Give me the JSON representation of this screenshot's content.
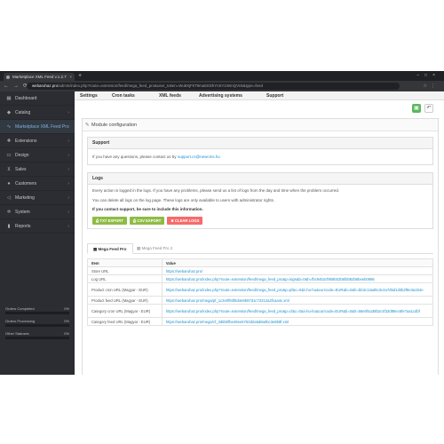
{
  "browser": {
    "tab_title": "Marketplace XML Feed v.1.2.7",
    "url_host": "webaruhaz.pro",
    "url_path": "/admin/index.php?route=extension/feed/mega_feed_pro&user_token=Wu8XjFkT9ma5XDhYnSY1WmQVnk&type=feed"
  },
  "sidebar": {
    "items": [
      {
        "label": "Dashboard",
        "icon": "dashboard-icon",
        "glyph": "▦"
      },
      {
        "label": "Catalog",
        "icon": "tag-icon",
        "glyph": "◆"
      },
      {
        "label": "Marketplace XML Feed Pro",
        "icon": "chart-icon",
        "glyph": "∿"
      },
      {
        "label": "Extensions",
        "icon": "puzzle-icon",
        "glyph": "✚"
      },
      {
        "label": "Design",
        "icon": "monitor-icon",
        "glyph": "▭"
      },
      {
        "label": "Sales",
        "icon": "cart-icon",
        "glyph": "⊻"
      },
      {
        "label": "Customers",
        "icon": "user-icon",
        "glyph": "●"
      },
      {
        "label": "Marketing",
        "icon": "share-icon",
        "glyph": "◁"
      },
      {
        "label": "System",
        "icon": "gear-icon",
        "glyph": "✲"
      },
      {
        "label": "Reports",
        "icon": "bar-chart-icon",
        "glyph": "▮"
      }
    ],
    "stats": [
      {
        "label": "Orders Completed",
        "value": "0%"
      },
      {
        "label": "Orders Processing",
        "value": "0%"
      },
      {
        "label": "Other Statuses",
        "value": "0%"
      }
    ]
  },
  "topnav": {
    "settings": "Settings",
    "cron": "Cron tasks",
    "xml": "XML feeds",
    "advertising": "Advertising systems",
    "support": "Support"
  },
  "panel": {
    "title": "Module configuration"
  },
  "support": {
    "heading": "Support",
    "text": "If you have any questions, please contact us by",
    "email": "support.cs@newcms.hu"
  },
  "logs": {
    "heading": "Logs",
    "line1": "Every action is logged in the logs. If you have any problems, please send us a list of logs from the day and time when the problem occurred.",
    "line2": "You can delete all logs on the log page. These logs are only available to users with administrator rights.",
    "line3": "If you contact support, be sure to include this information.",
    "btn_txt": "TXT EXPORT",
    "btn_csv": "CSV EXPORT",
    "btn_clear": "CLEAR LOGS"
  },
  "tabs": {
    "active": "Mega Feed Pro",
    "inactive": "Mega Feed Pro 2"
  },
  "table": {
    "headers": [
      "Item",
      "Value"
    ],
    "rows": [
      [
        "Store URL",
        "https://webaruhaz.pro/"
      ],
      [
        "Log URL",
        "https://webaruhaz.pro/index.php?route=extension/feed/mega_feed_pro&p=logs&b=0&h=fbc9452cf9b8b02b6fd082b6beeb0986"
      ],
      [
        "Product cron URL (Magyar - EUR)",
        "https://webaruhaz.pro/index.php?route=extension/feed/mega_feed_pro&p=pf&c=0&l=hu-hu&currcode=EUR&b=0&h=bb3c13ad6c3c4a7d5d1d3b2f8e3a1b4e"
      ],
      [
        "Product feed URL (Magyar - EUR)",
        "https://webaruhaz.pro/mega/pf_1c2e0f93f8d4e9b57d1c72212a2fcaa4c.xml"
      ],
      [
        "Category cron URL (Magyar - EUR)",
        "https://webaruhaz.pro/index.php?route=extension/feed/mega_feed_pro&p=cf&c=0&l=hu-hu&currcode=EUR&b=0&h=58e0f4a38b2c4f33d88ec6fe7aa1cdbf"
      ],
      [
        "Category feed URL (Magyar - EUR)",
        "https://webaruhaz.pro/mega/cf_3d5b0fbe49ee5763d2a5d8a0bc3e8b8f.xml"
      ]
    ]
  }
}
